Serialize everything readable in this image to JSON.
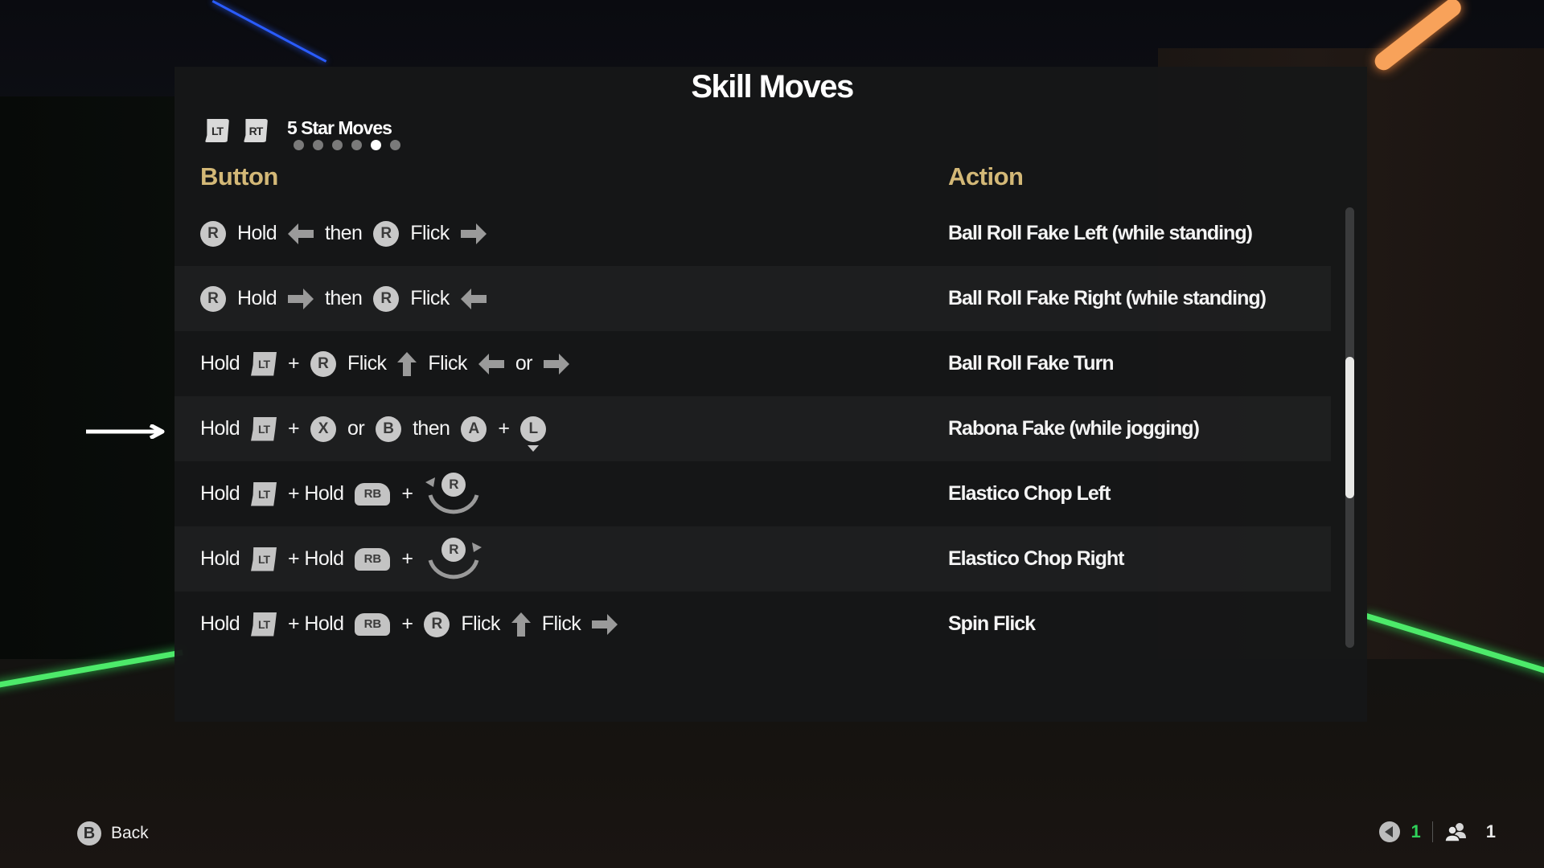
{
  "title": "Skill Moves",
  "category": {
    "prev_trigger": "LT",
    "next_trigger": "RT",
    "label": "5 Star Moves",
    "page_count": 6,
    "active_page_index": 4
  },
  "columns": {
    "button": "Button",
    "action": "Action"
  },
  "colors": {
    "header_gold": "#d3b877",
    "status_green": "#2fd15a"
  },
  "icons": {
    "R": "R",
    "L": "L",
    "LT": "LT",
    "RT": "RT",
    "RB": "RB",
    "X": "X",
    "B": "B",
    "A": "A"
  },
  "rows": [
    {
      "action": "Ball Roll Fake Left (while standing)",
      "sequence": [
        {
          "type": "stick",
          "label": "R"
        },
        {
          "type": "text",
          "text": "Hold"
        },
        {
          "type": "arrow",
          "dir": "left"
        },
        {
          "type": "text",
          "text": "then"
        },
        {
          "type": "stick",
          "label": "R"
        },
        {
          "type": "text",
          "text": "Flick"
        },
        {
          "type": "arrow",
          "dir": "right"
        }
      ]
    },
    {
      "action": "Ball Roll Fake Right (while standing)",
      "sequence": [
        {
          "type": "stick",
          "label": "R"
        },
        {
          "type": "text",
          "text": "Hold"
        },
        {
          "type": "arrow",
          "dir": "right"
        },
        {
          "type": "text",
          "text": "then"
        },
        {
          "type": "stick",
          "label": "R"
        },
        {
          "type": "text",
          "text": "Flick"
        },
        {
          "type": "arrow",
          "dir": "left"
        }
      ]
    },
    {
      "action": "Ball Roll Fake Turn",
      "sequence": [
        {
          "type": "text",
          "text": "Hold"
        },
        {
          "type": "trigger",
          "label": "LT"
        },
        {
          "type": "text",
          "text": "+"
        },
        {
          "type": "stick",
          "label": "R"
        },
        {
          "type": "text",
          "text": "Flick"
        },
        {
          "type": "arrow",
          "dir": "up"
        },
        {
          "type": "text",
          "text": "Flick"
        },
        {
          "type": "arrow",
          "dir": "left"
        },
        {
          "type": "text",
          "text": "or"
        },
        {
          "type": "arrow",
          "dir": "right"
        }
      ]
    },
    {
      "action": "Rabona Fake (while jogging)",
      "selected": true,
      "sequence": [
        {
          "type": "text",
          "text": "Hold"
        },
        {
          "type": "trigger",
          "label": "LT"
        },
        {
          "type": "text",
          "text": "+"
        },
        {
          "type": "face",
          "label": "X"
        },
        {
          "type": "text",
          "text": "or"
        },
        {
          "type": "face",
          "label": "B"
        },
        {
          "type": "text",
          "text": "then"
        },
        {
          "type": "face",
          "label": "A"
        },
        {
          "type": "text",
          "text": "+"
        },
        {
          "type": "lstick",
          "label": "L"
        }
      ]
    },
    {
      "action": "Elastico Chop Left",
      "sequence": [
        {
          "type": "text",
          "text": "Hold"
        },
        {
          "type": "trigger",
          "label": "LT"
        },
        {
          "type": "text",
          "text": "+ Hold"
        },
        {
          "type": "bumper",
          "label": "RB"
        },
        {
          "type": "text",
          "text": "+"
        },
        {
          "type": "rotate",
          "label": "R",
          "dir": "left"
        }
      ]
    },
    {
      "action": "Elastico Chop Right",
      "sequence": [
        {
          "type": "text",
          "text": "Hold"
        },
        {
          "type": "trigger",
          "label": "LT"
        },
        {
          "type": "text",
          "text": "+ Hold"
        },
        {
          "type": "bumper",
          "label": "RB"
        },
        {
          "type": "text",
          "text": "+"
        },
        {
          "type": "rotate",
          "label": "R",
          "dir": "right"
        }
      ]
    },
    {
      "action": "Spin Flick",
      "sequence": [
        {
          "type": "text",
          "text": "Hold"
        },
        {
          "type": "trigger",
          "label": "LT"
        },
        {
          "type": "text",
          "text": "+ Hold"
        },
        {
          "type": "bumper",
          "label": "RB"
        },
        {
          "type": "text",
          "text": "+"
        },
        {
          "type": "stick",
          "label": "R"
        },
        {
          "type": "text",
          "text": "Flick"
        },
        {
          "type": "arrow",
          "dir": "up"
        },
        {
          "type": "text",
          "text": "Flick"
        },
        {
          "type": "arrow",
          "dir": "right"
        }
      ]
    }
  ],
  "scroll": {
    "position_fraction": 0.5,
    "visible_fraction": 0.32
  },
  "footer": {
    "back_button": "B",
    "back_label": "Back",
    "voice_count": "1",
    "players_count": "1"
  }
}
